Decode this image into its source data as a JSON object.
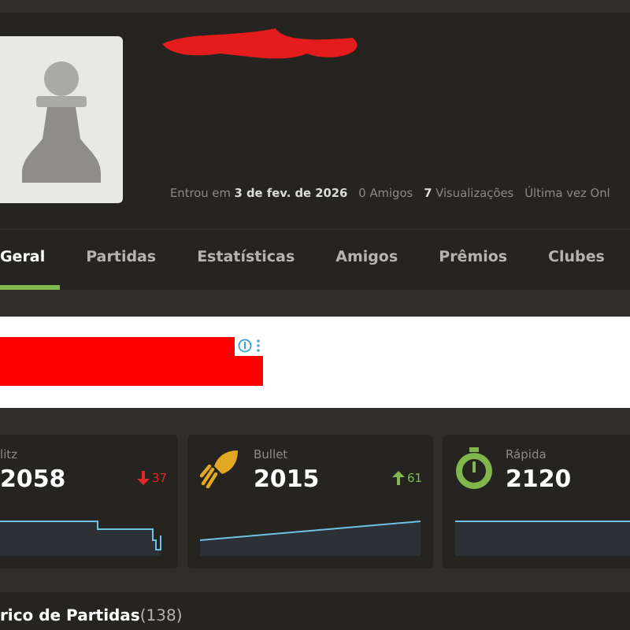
{
  "profile": {
    "joined": "Entrou em **3 de fev. de 2026**",
    "friends": "0 Amigos",
    "views": "**7** Visualizações",
    "last_online": "Última vez Onl"
  },
  "tabs": [
    {
      "label": "Geral",
      "selected": true
    },
    {
      "label": "Partidas",
      "selected": false
    },
    {
      "label": "Estatísticas",
      "selected": false
    },
    {
      "label": "Amigos",
      "selected": false
    },
    {
      "label": "Prêmios",
      "selected": false
    },
    {
      "label": "Clubes",
      "selected": false
    }
  ],
  "ratings": [
    {
      "kind": "blitz",
      "name": "litz",
      "rating": "2058",
      "rising": false,
      "change": "37"
    },
    {
      "kind": "bullet",
      "name": "Bullet",
      "rating": "2015",
      "rising": true,
      "change": "61"
    },
    {
      "kind": "rapid",
      "name": "Rápida",
      "rating": "2120"
    }
  ],
  "history": {
    "title": "rico de Partidas",
    "count": "(138)"
  }
}
